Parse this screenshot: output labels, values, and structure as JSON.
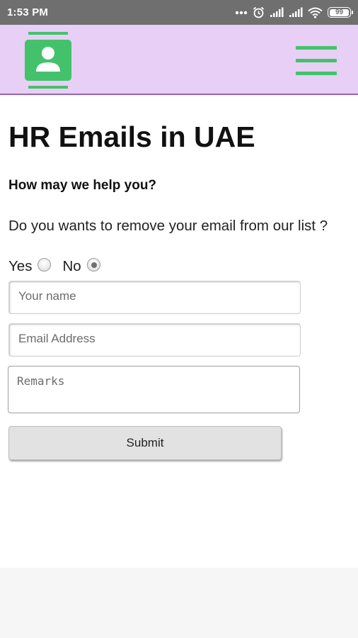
{
  "status_bar": {
    "time": "1:53 PM",
    "icons": [
      "more-dots-icon",
      "alarm-icon",
      "signal-icon",
      "signal-icon",
      "wifi-icon",
      "battery-icon"
    ],
    "battery_level": "99"
  },
  "header": {
    "logo_icon": "contacts-book-icon",
    "menu_icon": "hamburger-menu-icon",
    "accent_color": "#43c26b",
    "background_color": "#e8cff5"
  },
  "page": {
    "title": "HR Emails in UAE",
    "subtitle": "How may we help you?",
    "question": "Do you wants to remove your email from our list ?",
    "options": [
      {
        "label": "Yes",
        "selected": false
      },
      {
        "label": "No",
        "selected": true
      }
    ]
  },
  "form": {
    "name_placeholder": "Your name",
    "email_placeholder": "Email Address",
    "remarks_placeholder": "Remarks",
    "submit_label": "Submit"
  }
}
